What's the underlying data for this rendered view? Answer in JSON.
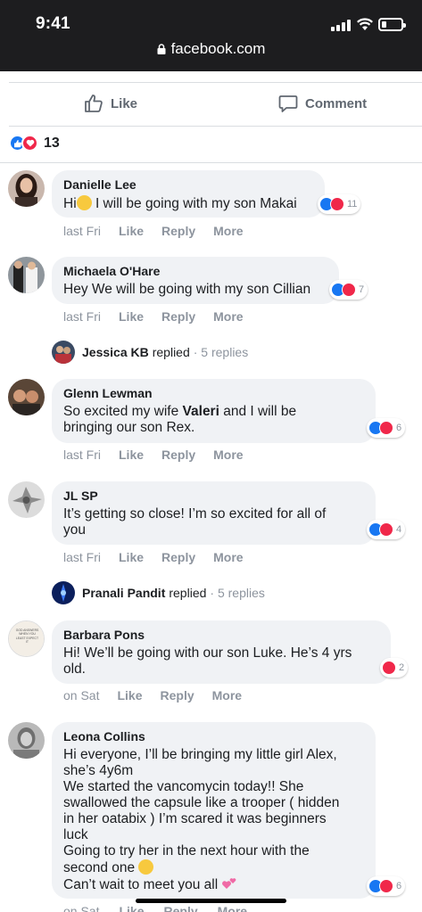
{
  "status": {
    "time": "9:41"
  },
  "browser": {
    "url": "facebook.com"
  },
  "actions": {
    "like": "Like",
    "comment": "Comment"
  },
  "reactions": {
    "count": "13"
  },
  "comments": [
    {
      "author": "Danielle Lee",
      "text_before": "Hi",
      "text_after": " I will be going with my son Makai",
      "time": "last Fri",
      "like": "Like",
      "reply": "Reply",
      "more": "More",
      "reaction_count": "11"
    },
    {
      "author": "Michaela O'Hare",
      "text": "Hey We will be going with my son Cillian",
      "time": "last Fri",
      "like": "Like",
      "reply": "Reply",
      "more": "More",
      "reaction_count": "7",
      "replies": {
        "name": "Jessica KB",
        "verb": "replied",
        "count": "· 5 replies"
      }
    },
    {
      "author": "Glenn Lewman",
      "text_before": "So excited my wife ",
      "text_bold": "Valeri",
      "text_after": " and I will be\nbringing our son Rex.",
      "time": "last Fri",
      "like": "Like",
      "reply": "Reply",
      "more": "More",
      "reaction_count": "6"
    },
    {
      "author": "JL SP",
      "text": "It’s getting so close! I’m so excited for all of\nyou",
      "time": "last Fri",
      "like": "Like",
      "reply": "Reply",
      "more": "More",
      "reaction_count": "4",
      "replies": {
        "name": "Pranali Pandit",
        "verb": "replied",
        "count": "· 5 replies"
      }
    },
    {
      "author": "Barbara Pons",
      "text": "Hi! We’ll be going with our son Luke. He’s 4 yrs\nold.",
      "time": "on Sat",
      "like": "Like",
      "reply": "Reply",
      "more": "More",
      "reaction_count": "2"
    },
    {
      "author": "Leona Collins",
      "text_1": "Hi everyone, I’ll be bringing my little girl Alex,\nshe’s 4y6m\nWe started the vancomycin today!! She\nswallowed the capsule like a trooper ( hidden\nin her oatabix ) I’m scared it was beginners\nluck\nGoing to try her in the next hour with the\nsecond one ",
      "text_2": "\nCan’t wait to meet you all ",
      "time": "on Sat",
      "like": "Like",
      "reply": "Reply",
      "more": "More",
      "reaction_count": "6"
    }
  ],
  "avatar_sign_text": "GOD ANSWERS WHEN YOU LEAST EXPECT IT",
  "icons": {
    "like": "thumbs-up-icon",
    "comment": "speech-bubble-icon",
    "lock": "lock-icon"
  },
  "colors": {
    "like_blue": "#1877f2",
    "love_red": "#f0284a",
    "bubble_gray": "#f0f2f5",
    "meta_gray": "#8d949e"
  }
}
